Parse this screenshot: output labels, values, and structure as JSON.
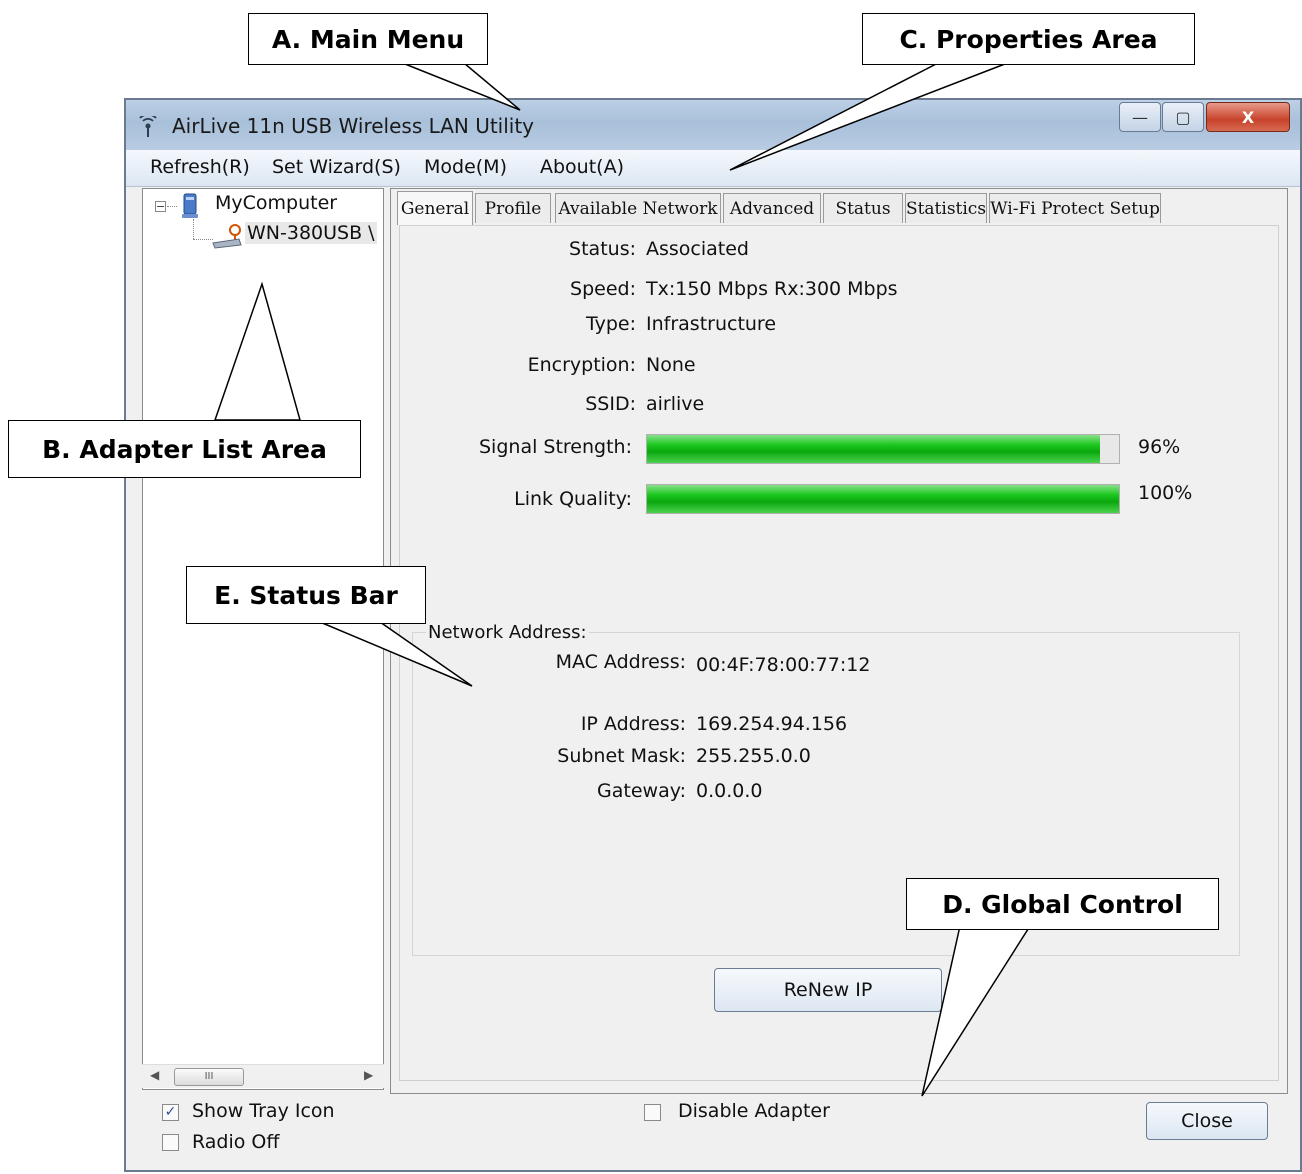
{
  "window": {
    "title": "AirLive 11n USB Wireless LAN Utility",
    "caption_buttons": {
      "minimize": "—",
      "maximize": "▢",
      "close": "X"
    }
  },
  "menu": {
    "refresh": "Refresh(R)",
    "wizard": "Set Wizard(S)",
    "mode": "Mode(M)",
    "about": "About(A)"
  },
  "tree": {
    "root": "MyComputer",
    "child": "WN-380USB \\",
    "expander": "−"
  },
  "scrollbar": {
    "left": "◀",
    "thumb": "III",
    "right": "▶"
  },
  "tabs": [
    "General",
    "Profile",
    "Available Network",
    "Advanced",
    "Status",
    "Statistics",
    "Wi-Fi Protect Setup"
  ],
  "general": {
    "status_label": "Status:",
    "status_value": "Associated",
    "speed_label": "Speed:",
    "speed_value": "Tx:150 Mbps Rx:300 Mbps",
    "type_label": "Type:",
    "type_value": "Infrastructure",
    "encryption_label": "Encryption:",
    "encryption_value": "None",
    "ssid_label": "SSID:",
    "ssid_value": "airlive",
    "signal_label": "Signal Strength:",
    "signal_value": "96%",
    "signal_fraction": 0.96,
    "link_label": "Link Quality:",
    "link_value": "100%",
    "link_fraction": 1.0
  },
  "network": {
    "group_title": "Network Address:",
    "mac_label": "MAC Address:",
    "mac_value": "00:4F:78:00:77:12",
    "ip_label": "IP Address:",
    "ip_value": "169.254.94.156",
    "mask_label": "Subnet Mask:",
    "mask_value": "255.255.0.0",
    "gateway_label": "Gateway:",
    "gateway_value": "0.0.0.0"
  },
  "buttons": {
    "renew": "ReNew IP",
    "close": "Close"
  },
  "global": {
    "show_tray": "Show Tray Icon",
    "show_tray_checked": true,
    "radio_off": "Radio Off",
    "radio_off_checked": false,
    "disable_adapter": "Disable Adapter",
    "disable_adapter_checked": false,
    "check_glyph": "✓"
  },
  "callouts": {
    "main_menu": "A. Main Menu",
    "properties": "C. Properties Area",
    "adapter_list": "B. Adapter List Area",
    "status_bar": "E. Status Bar",
    "global_control": "D. Global Control"
  },
  "colors": {
    "bar_green": "#1cc81f",
    "titlebar": "#b8cce2",
    "close_red": "#c8432a"
  }
}
